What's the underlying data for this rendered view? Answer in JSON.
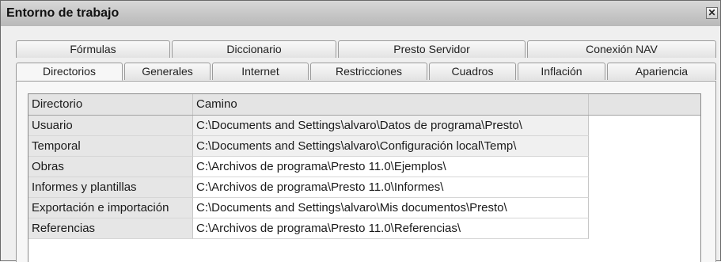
{
  "window": {
    "title": "Entorno de trabajo",
    "close_glyph": "✕"
  },
  "tabs_back": [
    "Fórmulas",
    "Diccionario",
    "Presto Servidor",
    "Conexión NAV"
  ],
  "tabs_front": [
    "Directorios",
    "Generales",
    "Internet",
    "Restricciones",
    "Cuadros",
    "Inflación",
    "Apariencia"
  ],
  "active_tab": "Directorios",
  "table": {
    "columns": [
      "Directorio",
      "Camino"
    ],
    "rows": [
      {
        "directorio": "Usuario",
        "camino": "C:\\Documents and Settings\\alvaro\\Datos de programa\\Presto\\"
      },
      {
        "directorio": "Temporal",
        "camino": "C:\\Documents and Settings\\alvaro\\Configuración local\\Temp\\"
      },
      {
        "directorio": "Obras",
        "camino": "C:\\Archivos de programa\\Presto 11.0\\Ejemplos\\"
      },
      {
        "directorio": "Informes y plantillas",
        "camino": "C:\\Archivos de programa\\Presto 11.0\\Informes\\"
      },
      {
        "directorio": "Exportación e importación",
        "camino": "C:\\Documents and Settings\\alvaro\\Mis documentos\\Presto\\"
      },
      {
        "directorio": "Referencias",
        "camino": "C:\\Archivos de programa\\Presto 11.0\\Referencias\\"
      }
    ]
  }
}
